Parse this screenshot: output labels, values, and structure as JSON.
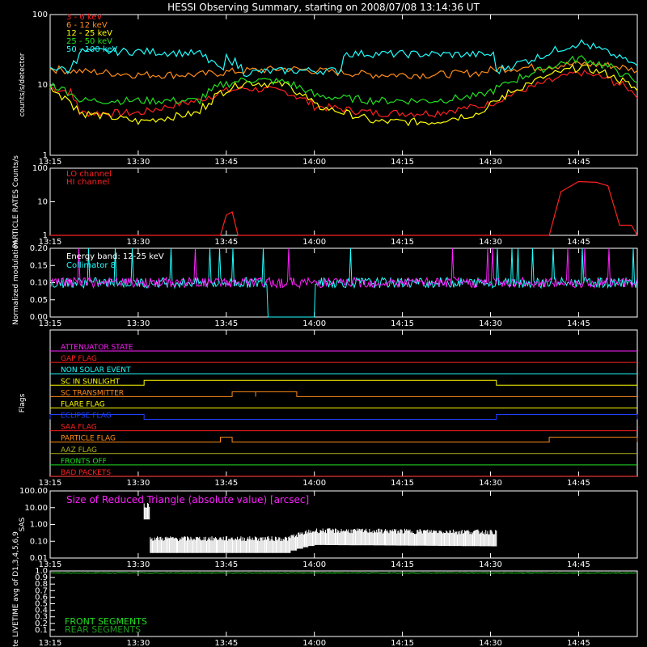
{
  "title": "HESSI Observing Summary, starting on 2008/07/08 13:14:36 UT",
  "time_ticks": [
    "13:15",
    "13:30",
    "13:45",
    "14:00",
    "14:15",
    "14:30",
    "14:45"
  ],
  "colors": {
    "red": "#ff2020",
    "orange": "#ff8c1a",
    "yellow": "#ffff00",
    "green": "#20e020",
    "cyan": "#20ffff",
    "magenta": "#ff20ff",
    "blue": "#2040ff",
    "white": "#ffffff",
    "olive": "#b0b020",
    "darkgreen": "#1a9a1a"
  },
  "chart_data": [
    {
      "type": "line",
      "panel": "count_rates",
      "ylabel": "counts/s/detector",
      "y_scale": "log",
      "ylim": [
        1,
        100
      ],
      "y_ticks": [
        "100",
        "10",
        "1"
      ],
      "x_range": [
        "13:15",
        "14:55"
      ],
      "series": [
        {
          "name": "3 - 6 keV",
          "color": "red",
          "x": [
            "13:15",
            "13:18",
            "13:20",
            "13:30",
            "13:40",
            "13:44",
            "13:48",
            "13:55",
            "14:00",
            "14:10",
            "14:20",
            "14:28",
            "14:31",
            "14:38",
            "14:45",
            "14:50",
            "14:55"
          ],
          "y": [
            9,
            8,
            4,
            4,
            6,
            8,
            9,
            8,
            5,
            4,
            4,
            5,
            6,
            10,
            15,
            12,
            7
          ]
        },
        {
          "name": "6 - 12 keV",
          "color": "orange",
          "x": [
            "13:15",
            "13:18",
            "13:30",
            "13:40",
            "13:44",
            "13:48",
            "13:55",
            "14:00",
            "14:10",
            "14:20",
            "14:28",
            "14:31",
            "14:38",
            "14:45",
            "14:50",
            "14:55"
          ],
          "y": [
            17,
            16,
            14,
            14,
            15,
            16,
            17,
            16,
            14,
            14,
            15,
            17,
            18,
            20,
            19,
            16
          ]
        },
        {
          "name": "12 - 25 keV",
          "color": "yellow",
          "x": [
            "13:15",
            "13:18",
            "13:20",
            "13:30",
            "13:40",
            "13:44",
            "13:48",
            "13:55",
            "14:00",
            "14:10",
            "14:20",
            "14:28",
            "14:31",
            "14:38",
            "14:45",
            "14:50",
            "14:55"
          ],
          "y": [
            9,
            6,
            4,
            3,
            4,
            8,
            11,
            10,
            5,
            3,
            3,
            4,
            6,
            12,
            18,
            14,
            8
          ]
        },
        {
          "name": "25 - 50 keV",
          "color": "green",
          "x": [
            "13:15",
            "13:18",
            "13:20",
            "13:30",
            "13:40",
            "13:44",
            "13:48",
            "13:55",
            "14:00",
            "14:10",
            "14:20",
            "14:28",
            "14:31",
            "14:38",
            "14:45",
            "14:50",
            "14:55"
          ],
          "y": [
            10,
            8,
            6,
            6,
            6,
            10,
            12,
            11,
            7,
            6,
            6,
            7,
            9,
            16,
            24,
            18,
            10
          ]
        },
        {
          "name": "50 - 100 keV",
          "color": "cyan",
          "x": [
            "13:15",
            "13:18",
            "13:20",
            "13:30",
            "13:40",
            "13:44",
            "13:45",
            "13:48",
            "13:55",
            "14:04",
            "14:05",
            "14:30",
            "14:31",
            "14:38",
            "14:45",
            "14:50",
            "14:55"
          ],
          "y": [
            18,
            16,
            30,
            30,
            28,
            16,
            25,
            15,
            16,
            16,
            28,
            27,
            16,
            25,
            40,
            28,
            18
          ]
        }
      ]
    },
    {
      "type": "line",
      "panel": "particle_rates",
      "ylabel": "PARTICLE RATES Counts/s",
      "y_scale": "log",
      "ylim": [
        1,
        100
      ],
      "y_ticks": [
        "100",
        "10",
        "1"
      ],
      "series": [
        {
          "name": "LO channel",
          "color": "red",
          "x": [],
          "y": []
        },
        {
          "name": "HI channel",
          "color": "red",
          "x": [
            "13:15",
            "13:44",
            "13:45",
            "13:46",
            "13:47",
            "14:40",
            "14:42",
            "14:45",
            "14:48",
            "14:50",
            "14:52",
            "14:54",
            "14:55"
          ],
          "y": [
            1,
            1,
            4,
            5,
            1,
            1,
            20,
            40,
            38,
            30,
            2,
            2,
            1
          ]
        }
      ]
    },
    {
      "type": "line",
      "panel": "modulation",
      "ylabel": "Normalized modulation",
      "ylim": [
        0,
        0.2
      ],
      "y_ticks": [
        "0.20",
        "0.15",
        "0.10",
        "0.05",
        "0.00"
      ],
      "annotations": [
        "Energy band: 12-25 keV",
        "Collimator 8"
      ],
      "series": [
        {
          "name": "Collimator 8",
          "color": "cyan",
          "level": 0.1,
          "dropout": [
            "13:52",
            "14:00"
          ]
        },
        {
          "name": "modulation",
          "color": "magenta",
          "level": 0.1
        }
      ]
    },
    {
      "type": "step",
      "panel": "flags",
      "ylabel": "Flags",
      "flags": [
        {
          "name": "ATTENUATOR STATE",
          "color": "magenta",
          "on": []
        },
        {
          "name": "GAP FLAG",
          "color": "red",
          "on": []
        },
        {
          "name": "NON SOLAR EVENT",
          "color": "cyan",
          "on": []
        },
        {
          "name": "SC IN SUNLIGHT",
          "color": "yellow",
          "on": [
            [
              "13:31",
              "14:31"
            ]
          ]
        },
        {
          "name": "SC TRANSMITTER",
          "color": "orange",
          "on": [
            [
              "13:46",
              "13:50"
            ],
            [
              "13:50",
              "13:57"
            ]
          ]
        },
        {
          "name": "FLARE FLAG",
          "color": "yellow",
          "on": []
        },
        {
          "name": "ECLIPSE FLAG",
          "color": "blue",
          "on": [
            [
              "13:15",
              "13:31"
            ],
            [
              "14:31",
              "14:55"
            ]
          ]
        },
        {
          "name": "SAA FLAG",
          "color": "red",
          "on": []
        },
        {
          "name": "PARTICLE FLAG",
          "color": "orange",
          "on": [
            [
              "13:44",
              "13:46"
            ],
            [
              "14:40",
              "14:55"
            ]
          ]
        },
        {
          "name": "AAZ FLAG",
          "color": "olive",
          "on": []
        },
        {
          "name": "FRONTS OFF",
          "color": "green",
          "on": []
        },
        {
          "name": "BAD PACKETS",
          "color": "red",
          "on": []
        }
      ]
    },
    {
      "type": "line",
      "panel": "sas",
      "ylabel": "SAS",
      "y_scale": "log",
      "ylim": [
        0.01,
        100
      ],
      "y_ticks": [
        "100.00",
        "10.00",
        "1.00",
        "0.10",
        "0.01"
      ],
      "annotation": "Size of Reduced Triangle (absolute value) [arcsec]",
      "series": [
        {
          "name": "triangle",
          "color": "white",
          "x": [
            "13:31",
            "13:32",
            "13:45",
            "13:55",
            "14:00",
            "14:30",
            "14:31"
          ],
          "y": [
            10,
            0.1,
            0.1,
            0.1,
            0.3,
            0.25,
            80
          ]
        }
      ]
    },
    {
      "type": "line",
      "panel": "livetime",
      "ylabel": "Mon. Rate LIVETIME avg of D1,3,4,5,6,9",
      "ylim": [
        0,
        1
      ],
      "y_ticks": [
        "1.0",
        "0.9",
        "0.8",
        "0.7",
        "0.6",
        "0.5",
        "0.4",
        "0.3",
        "0.2",
        "0.1"
      ],
      "series": [
        {
          "name": "FRONT SEGMENTS",
          "color": "green",
          "level": 0.97
        },
        {
          "name": "REAR SEGMENTS",
          "color": "darkgreen",
          "level": 0.97
        }
      ]
    }
  ]
}
